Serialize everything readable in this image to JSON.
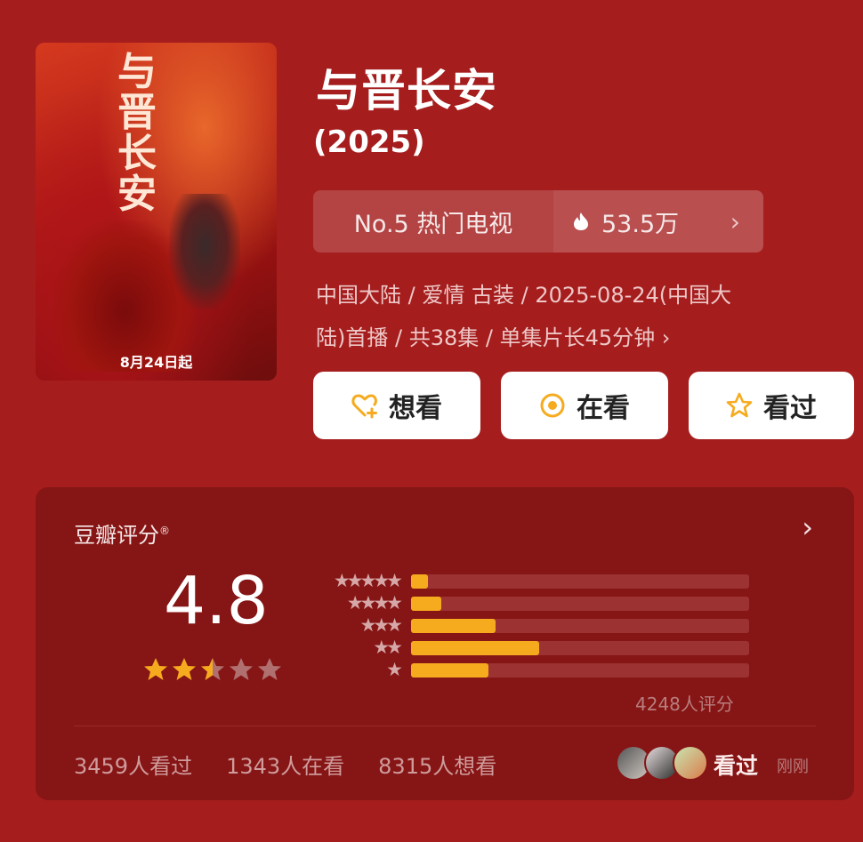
{
  "poster": {
    "title_chars": "与晋长安",
    "date_text": "8月24日起"
  },
  "show": {
    "title": "与晋长安",
    "year": "(2025)",
    "rank_label": "No.5 热门电视",
    "heat_value": "53.5万",
    "meta_line1": "中国大陆 / 爱情 古装 / 2025-08-24(中国大",
    "meta_line2": "陆)首播 / 共38集 / 单集片长45分钟 ›"
  },
  "actions": {
    "want": "想看",
    "watching": "在看",
    "watched": "看过"
  },
  "rating": {
    "title": "豆瓣评分",
    "title_mark": "®",
    "score": "4.8",
    "score_stars": 2.5,
    "distribution": [
      {
        "stars": "★★★★★",
        "percent": 5
      },
      {
        "stars": "★★★★",
        "percent": 9
      },
      {
        "stars": "★★★",
        "percent": 25
      },
      {
        "stars": "★★",
        "percent": 38
      },
      {
        "stars": "★",
        "percent": 23
      }
    ],
    "count_text": "4248人评分"
  },
  "stats": {
    "watched": "3459人看过",
    "watching": "1343人在看",
    "want": "8315人想看"
  },
  "friends": {
    "label": "看过",
    "time": "刚刚"
  },
  "colors": {
    "background": "#a51d1d",
    "card": "#861515",
    "bar_fill": "#f6ab1f",
    "star_active": "#f6ab1f",
    "star_inactive": "#b07070"
  }
}
